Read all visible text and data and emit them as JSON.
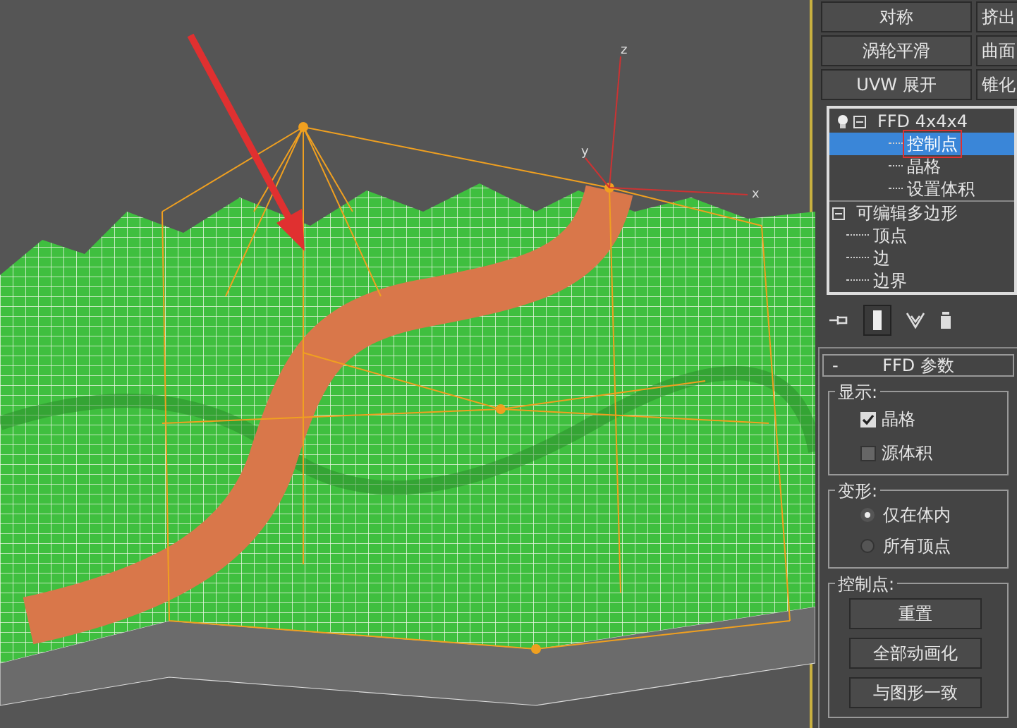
{
  "viewport": {
    "axis_labels": [
      "z",
      "y",
      "x"
    ]
  },
  "command_panel": {
    "modifier_buttons": [
      {
        "label": "对称"
      },
      {
        "label": "挤出"
      },
      {
        "label": "涡轮平滑"
      },
      {
        "label": "曲面"
      },
      {
        "label": "UVW 展开"
      },
      {
        "label": "锥化"
      }
    ],
    "modifier_stack": [
      {
        "label": "FFD 4x4x4",
        "kind": "modifier",
        "selected": false,
        "marked": false,
        "expanded": true,
        "children": [
          {
            "label": "控制点",
            "selected": true,
            "marked": true
          },
          {
            "label": "晶格",
            "selected": false,
            "marked": false
          },
          {
            "label": "设置体积",
            "selected": false,
            "marked": false
          }
        ]
      },
      {
        "label": "可编辑多边形",
        "kind": "object",
        "selected": false,
        "marked": false,
        "expanded": true,
        "children": [
          {
            "label": "顶点",
            "selected": false,
            "marked": false
          },
          {
            "label": "边",
            "selected": false,
            "marked": false
          },
          {
            "label": "边界",
            "selected": false,
            "marked": false
          }
        ]
      }
    ],
    "rollout": {
      "collapse_symbol": "-",
      "title": "FFD 参数",
      "groups": [
        {
          "title": "显示:",
          "kind": "checkboxes",
          "items": [
            {
              "label": "晶格",
              "checked": true
            },
            {
              "label": "源体积",
              "checked": false
            }
          ]
        },
        {
          "title": "变形:",
          "kind": "radios",
          "items": [
            {
              "label": "仅在体内",
              "selected": true
            },
            {
              "label": "所有顶点",
              "selected": false
            }
          ]
        },
        {
          "title": "控制点:",
          "kind": "buttons",
          "items": [
            {
              "label": "重置"
            },
            {
              "label": "全部动画化"
            },
            {
              "label": "与图形一致"
            }
          ]
        }
      ]
    }
  }
}
